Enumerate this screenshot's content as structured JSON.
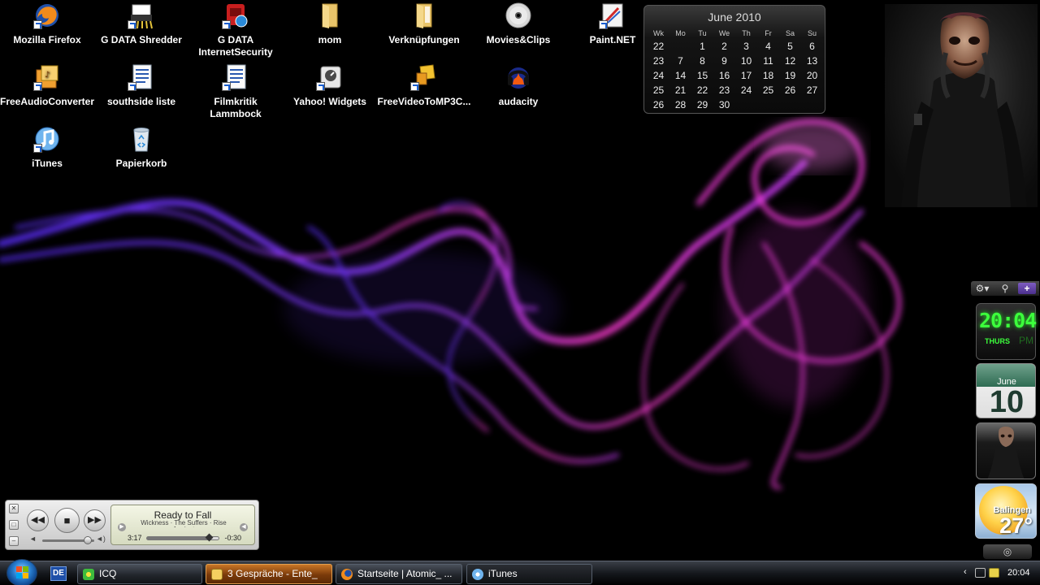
{
  "desktop": {
    "icons": [
      {
        "label": "Mozilla Firefox",
        "icon": "firefox-icon"
      },
      {
        "label": "G DATA Shredder",
        "icon": "shredder-icon"
      },
      {
        "label": "G DATA InternetSecurity",
        "icon": "gdata-icon"
      },
      {
        "label": "mom",
        "icon": "folder-icon"
      },
      {
        "label": "Verknüpfungen",
        "icon": "folder-icon"
      },
      {
        "label": "Movies&Clips",
        "icon": "disc-icon"
      },
      {
        "label": "Paint.NET",
        "icon": "paint-icon"
      },
      {
        "label": "FreeAudioConverter",
        "icon": "audio-converter-icon"
      },
      {
        "label": "southside liste",
        "icon": "document-icon"
      },
      {
        "label": "Filmkritik Lammbock",
        "icon": "document-icon"
      },
      {
        "label": "Yahoo! Widgets",
        "icon": "widgets-icon"
      },
      {
        "label": "FreeVideoToMP3C...",
        "icon": "video-converter-icon"
      },
      {
        "label": "audacity",
        "icon": "audacity-icon"
      },
      {
        "label": "iTunes",
        "icon": "itunes-icon"
      },
      {
        "label": "Papierkorb",
        "icon": "recycle-bin-icon"
      }
    ]
  },
  "calendar": {
    "title": "June 2010",
    "headers": [
      "Wk",
      "Mo",
      "Tu",
      "We",
      "Th",
      "Fr",
      "Sa",
      "Su"
    ],
    "rows": [
      [
        "22",
        "",
        "1",
        "2",
        "3",
        "4",
        "5",
        "6"
      ],
      [
        "23",
        "7",
        "8",
        "9",
        "10",
        "11",
        "12",
        "13"
      ],
      [
        "24",
        "14",
        "15",
        "16",
        "17",
        "18",
        "19",
        "20"
      ],
      [
        "25",
        "21",
        "22",
        "23",
        "24",
        "25",
        "26",
        "27"
      ],
      [
        "26",
        "28",
        "29",
        "30",
        "",
        "",
        "",
        ""
      ]
    ]
  },
  "sidebar": {
    "tools": [
      "gear-icon",
      "search-icon",
      "plus-icon"
    ],
    "clock": {
      "time": "20:04",
      "day": "THURS",
      "ampm": "PM"
    },
    "date": {
      "month": "June",
      "day": "10"
    },
    "weather": {
      "city": "Balingen",
      "temp": "27°"
    }
  },
  "mini_player": {
    "title": "Ready to Fall",
    "subtitle": "Wickness · The Suffers · Rise Against",
    "elapsed": "3:17",
    "remaining": "-0:30",
    "progress": 0.87,
    "volume": 0.88
  },
  "taskbar": {
    "language": "DE",
    "tasks": [
      {
        "label": "ICQ",
        "icon": "icq-icon",
        "state": "normal"
      },
      {
        "label": "3 Gespräche - Ente_",
        "icon": "chat-icon",
        "state": "active"
      },
      {
        "label": "Startseite | Atomic_ ...",
        "icon": "firefox-icon",
        "state": "normal"
      },
      {
        "label": "iTunes",
        "icon": "itunes-icon",
        "state": "dark"
      }
    ],
    "clock": "20:04"
  },
  "colors": {
    "clock_green": "#3cff3c",
    "smoke_violet": "#8a3cff",
    "smoke_magenta": "#ff3cd2",
    "active_task": "#c87626"
  }
}
